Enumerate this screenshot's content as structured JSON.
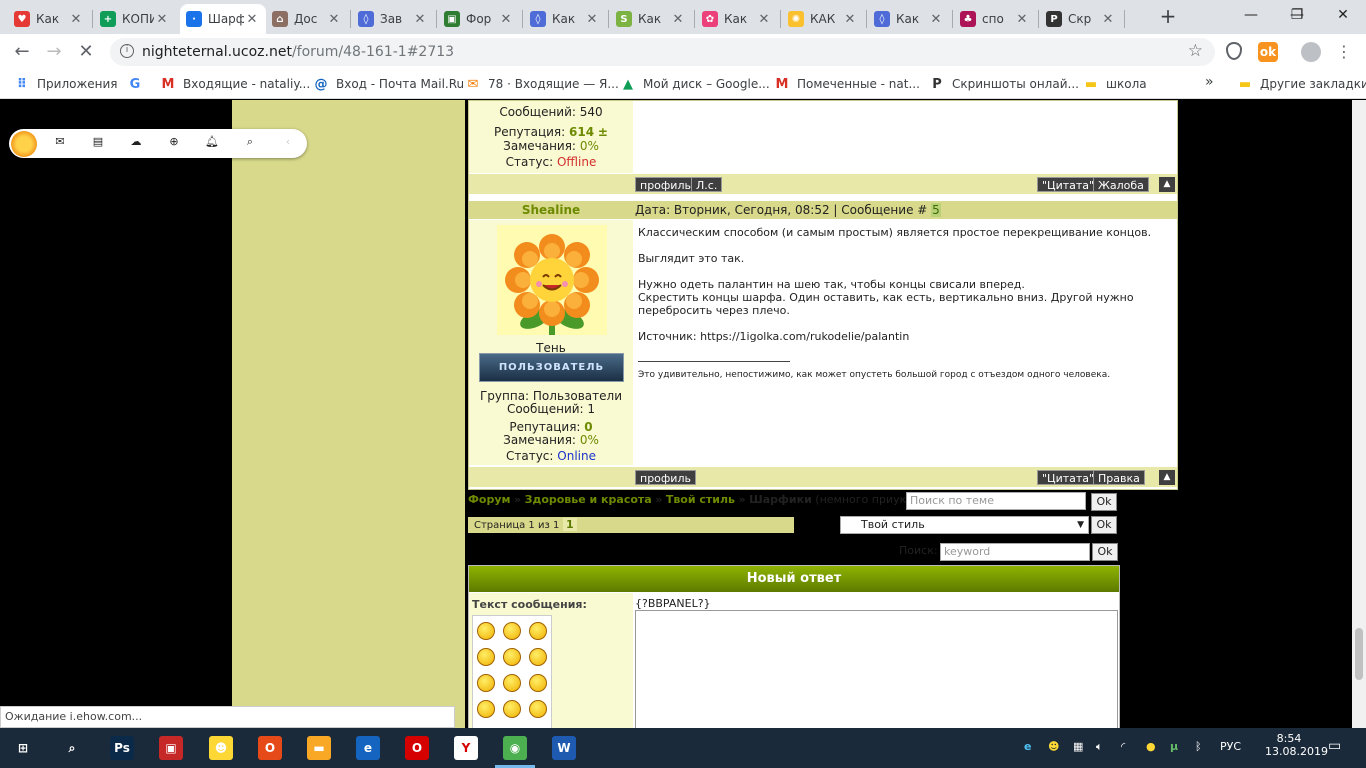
{
  "browser": {
    "tabs": [
      {
        "title": "Как",
        "color": "#e53935",
        "glyph": "♥"
      },
      {
        "title": "КОПИ",
        "color": "#0f9d58",
        "glyph": "+"
      },
      {
        "title": "Шарф",
        "color": "#1a73e8",
        "glyph": "·",
        "active": true
      },
      {
        "title": "Дос",
        "color": "#8d6e63",
        "glyph": "⌂"
      },
      {
        "title": "Зав",
        "color": "#4f6bd8",
        "glyph": "◊"
      },
      {
        "title": "Фор",
        "color": "#2e7d32",
        "glyph": "▣"
      },
      {
        "title": "Как",
        "color": "#4f6bd8",
        "glyph": "◊"
      },
      {
        "title": "Как",
        "color": "#7cb342",
        "glyph": "S"
      },
      {
        "title": "Как",
        "color": "#ec407a",
        "glyph": "✿"
      },
      {
        "title": "КАК",
        "color": "#fbc02d",
        "glyph": "✺"
      },
      {
        "title": "Как",
        "color": "#4f6bd8",
        "glyph": "◊"
      },
      {
        "title": "спо",
        "color": "#ad1457",
        "glyph": "♣"
      },
      {
        "title": "Скр",
        "color": "#333333",
        "glyph": "P"
      }
    ],
    "new_tab": "+",
    "window": {
      "minimize": "—",
      "restore": "❐",
      "close": "✕"
    },
    "url_host": "nighteternal.ucoz.net",
    "url_path": "/forum/48-161-1#2713",
    "bookmarks": [
      {
        "label": "Приложения",
        "icon": "apps-icon",
        "glyph": "⠿",
        "color": "#4285f4"
      },
      {
        "label": "",
        "icon": "google-icon",
        "glyph": "G",
        "color": "#4285f4"
      },
      {
        "label": "Входящие - nataliy...",
        "icon": "gmail-icon",
        "glyph": "M",
        "color": "#d93025"
      },
      {
        "label": "Вход - Почта Mail.Ru",
        "icon": "mailru-icon",
        "glyph": "@",
        "color": "#1565c0"
      },
      {
        "label": "78 · Входящие — Я...",
        "icon": "yandex-mail-icon",
        "glyph": "✉",
        "color": "#f57c00"
      },
      {
        "label": "Мой диск – Google...",
        "icon": "drive-icon",
        "glyph": "▲",
        "color": "#0f9d58"
      },
      {
        "label": "Помеченные - nat...",
        "icon": "gmail-icon",
        "glyph": "M",
        "color": "#d93025"
      },
      {
        "label": "Скриншоты онлай...",
        "icon": "prntscr-icon",
        "glyph": "P",
        "color": "#333333"
      },
      {
        "label": "школа",
        "icon": "folder-icon",
        "glyph": "▬",
        "color": "#f5c518"
      }
    ],
    "more_bookmarks": "»",
    "other_bookmarks": "Другие закладки",
    "status_text": "Ожидание i.ehow.com..."
  },
  "post_prev": {
    "messages_label": "Сообщений: 540",
    "rep_label": "Репутация:",
    "rep_value": "614",
    "rep_pm": "±",
    "warn_label": "Замечания:",
    "warn_value": "0%",
    "status_label": "Статус:",
    "status_value": "Offline",
    "btn_profile": "профиль",
    "btn_pm": "Л.с.",
    "btn_quote": "\"Цитата\"",
    "btn_report": "Жалоба"
  },
  "post": {
    "author": "Shealine",
    "header": "Дата: Вторник, Сегодня, 08:52 | Сообщение #",
    "number": "5",
    "rank_title": "Тень",
    "group_badge": "ПОЛЬЗОВАТЕЛЬ",
    "group": "Группа: Пользователи",
    "messages": "Сообщений: 1",
    "rep_label": "Репутация:",
    "rep_value": "0",
    "warn_label": "Замечания:",
    "warn_value": "0%",
    "status_label": "Статус:",
    "status_value": "Online",
    "lines": [
      "Классическим способом (и самым простым) является простое перекрещивание концов.",
      "",
      "Выглядит это так.",
      "",
      "Нужно одеть палантин на шею так, чтобы концы свисали вперед.",
      "Скрестить концы шарфа. Один оставить, как есть, вертикально вниз. Другой нужно",
      "перебросить через плечо.",
      "",
      "Источник: https://1igolka.com/rukodelie/palantin"
    ],
    "signature": "Это удивительно, непостижимо, как может опустеть большой город с отъездом одного человека.",
    "btn_profile": "профиль",
    "btn_quote": "\"Цитата\"",
    "btn_edit": "Правка"
  },
  "breadcrumb": {
    "items": [
      "Форум",
      "Здоровье и красота",
      "Твой стиль"
    ],
    "sep": "»",
    "current": "Шарфики",
    "current_desc": "(немного приукрасим себя)"
  },
  "topic_search": {
    "placeholder": "Поиск по теме",
    "ok": "Ok"
  },
  "pager": {
    "label": "Страница 1 из 1",
    "current": "1"
  },
  "jump": {
    "selected": "Твой стиль",
    "ok": "Ok"
  },
  "search": {
    "label": "Поиск:",
    "placeholder": "keyword",
    "ok": "Ok"
  },
  "reply": {
    "title": "Новый ответ",
    "text_label": "Текст сообщения:",
    "bbpanel": "{?BBPANEL?}",
    "smiles": [
      "angry-smile",
      "biggrin-smile",
      "cool-smile",
      "blink-smile",
      "dry-smile",
      "happy-smile",
      "sad-smile",
      "smile-smile",
      "surprised-smile",
      "tongue-smile",
      "unsure-smile",
      "wacko-smile"
    ]
  },
  "taskbar": {
    "apps": [
      {
        "name": "start-icon",
        "glyph": "⊞",
        "color": "#1b2a3a"
      },
      {
        "name": "search-icon",
        "glyph": "⌕",
        "color": "#1b2a3a"
      },
      {
        "name": "photoshop-icon",
        "glyph": "Ps",
        "color": "#0b2a4a"
      },
      {
        "name": "mediaplayer-icon",
        "glyph": "▣",
        "color": "#c62828"
      },
      {
        "name": "cyberghost-icon",
        "glyph": "☻",
        "color": "#fdd835"
      },
      {
        "name": "office-icon",
        "glyph": "O",
        "color": "#e64a19"
      },
      {
        "name": "explorer-icon",
        "glyph": "▬",
        "color": "#f9a825"
      },
      {
        "name": "edge-icon",
        "glyph": "e",
        "color": "#1565c0"
      },
      {
        "name": "opera-icon",
        "glyph": "O",
        "color": "#d50000"
      },
      {
        "name": "yandex-icon",
        "glyph": "Y",
        "color": "#ffffff"
      },
      {
        "name": "chrome-icon",
        "glyph": "◉",
        "color": "#4caf50"
      },
      {
        "name": "word-icon",
        "glyph": "W",
        "color": "#1e5bb0"
      }
    ],
    "lang": "РУС",
    "time": "8:54",
    "date": "13.08.2019"
  }
}
